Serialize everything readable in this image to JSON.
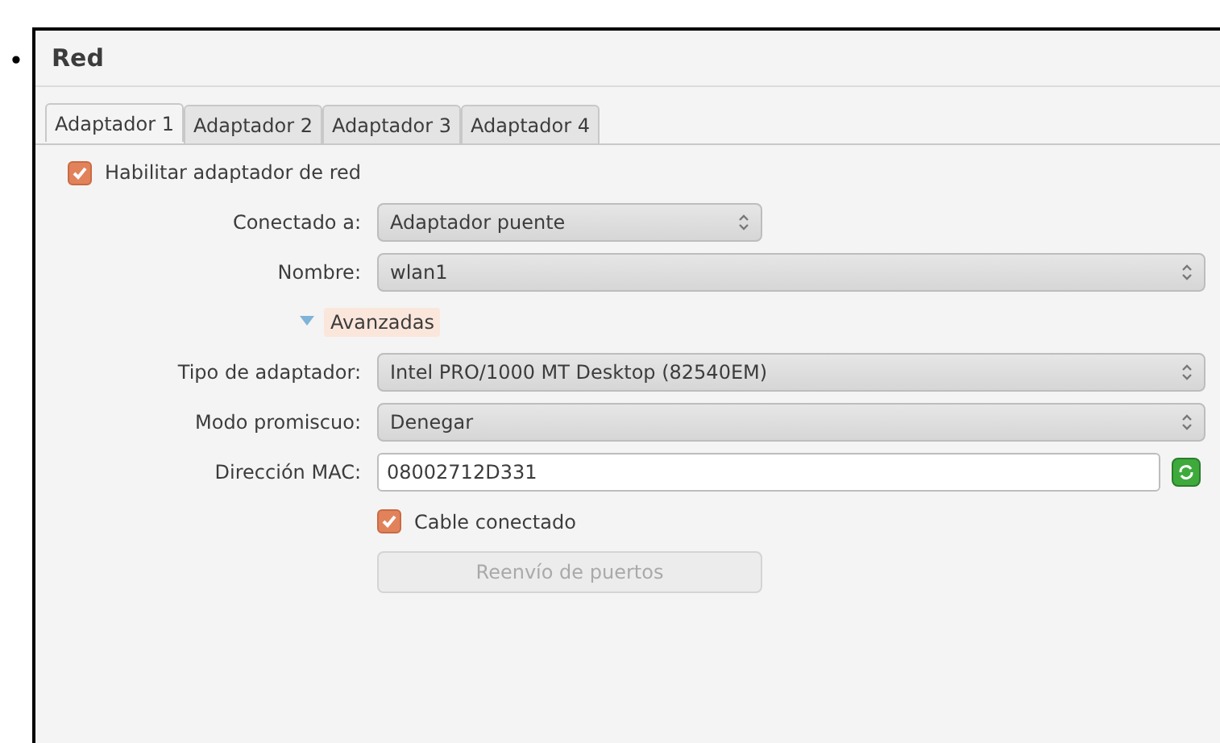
{
  "bullet": "•",
  "panel": {
    "title": "Red"
  },
  "tabs": [
    {
      "label": "Adaptador 1",
      "selected": true
    },
    {
      "label": "Adaptador 2",
      "selected": false
    },
    {
      "label": "Adaptador 3",
      "selected": false
    },
    {
      "label": "Adaptador 4",
      "selected": false
    }
  ],
  "enable_adapter": {
    "label": "Habilitar adaptador de red",
    "checked": true
  },
  "rows": [
    {
      "kind": "select",
      "label": "Conectado a:",
      "value": "Adaptador puente",
      "wide": false
    },
    {
      "kind": "select",
      "label": "Nombre:",
      "value": "wlan1",
      "wide": true
    },
    {
      "kind": "disclosure",
      "label": "Avanzadas",
      "expanded": true
    },
    {
      "kind": "select",
      "label": "Tipo de adaptador:",
      "value": "Intel PRO/1000 MT Desktop (82540EM)",
      "wide": true
    },
    {
      "kind": "select",
      "label": "Modo promiscuo:",
      "value": "Denegar",
      "wide": true
    },
    {
      "kind": "text",
      "label": "Dirección MAC:",
      "value": "08002712D331"
    },
    {
      "kind": "checkbox",
      "label": "Cable conectado",
      "checked": true
    },
    {
      "kind": "button",
      "label": "Reenvío de puertos",
      "disabled": true
    }
  ]
}
